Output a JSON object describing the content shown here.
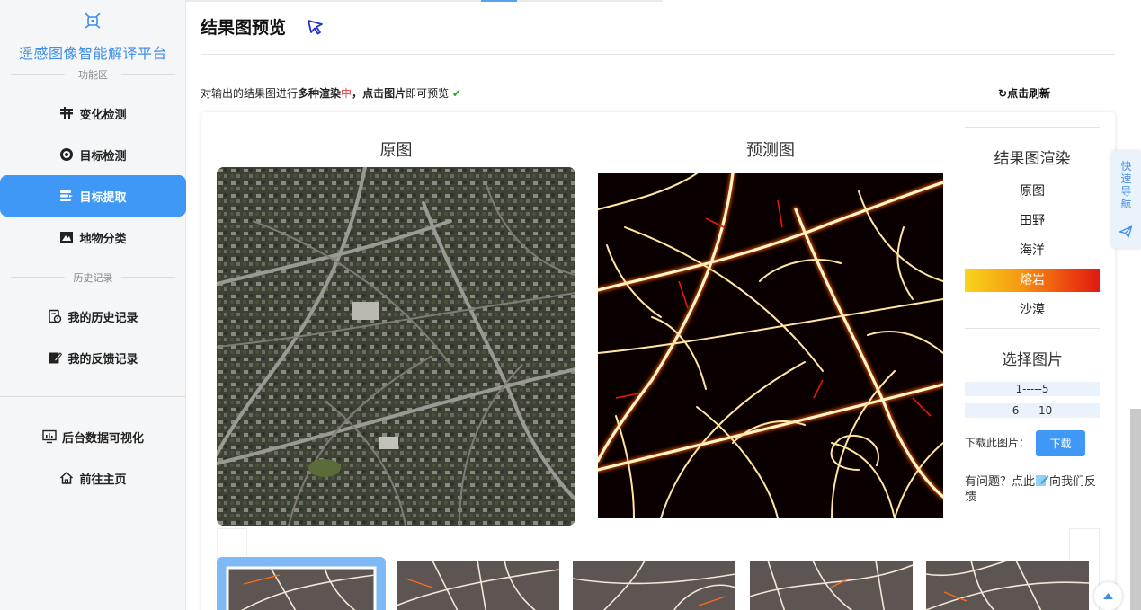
{
  "sidebar": {
    "app_title": "遥感图像智能解译平台",
    "section_function": "功能区",
    "section_history": "历史记录",
    "items": [
      {
        "label": "变化检测",
        "icon": "change-detection-icon"
      },
      {
        "label": "目标检测",
        "icon": "target-detection-icon"
      },
      {
        "label": "目标提取",
        "icon": "target-extraction-icon"
      },
      {
        "label": "地物分类",
        "icon": "land-classification-icon"
      },
      {
        "label": "我的历史记录",
        "icon": "history-icon"
      },
      {
        "label": "我的反馈记录",
        "icon": "feedback-icon"
      },
      {
        "label": "后台数据可视化",
        "icon": "dashboard-icon"
      },
      {
        "label": "前往主页",
        "icon": "home-icon"
      }
    ],
    "active_index": 2
  },
  "header": {
    "title": "结果图预览"
  },
  "hint": {
    "part1": "对输出的结果图进行",
    "bold1": "多种渲染",
    "red_mark": "中",
    "comma": "，",
    "bold2": "点击图片",
    "part2": "即可预览",
    "check": "✔"
  },
  "refresh": {
    "icon": "↻",
    "label": "点击刷新"
  },
  "preview": {
    "original_label": "原图",
    "predicted_label": "预测图"
  },
  "render_panel": {
    "title": "结果图渲染",
    "options": [
      "原图",
      "田野",
      "海洋",
      "熔岩",
      "沙漠"
    ],
    "selected": "熔岩",
    "select_title": "选择图片",
    "ranges": [
      "1-----5",
      "6-----10"
    ],
    "download_label": "下载此图片：",
    "download_button": "下载",
    "feedback_prefix": "有问题？点此",
    "feedback_suffix": "向我们反馈"
  },
  "quick_nav": {
    "label": "快速导航"
  },
  "colors": {
    "accent": "#3f98f6",
    "title_blue": "#3f8ee8",
    "lava_start": "#f9d41a",
    "lava_end": "#e01a10"
  }
}
